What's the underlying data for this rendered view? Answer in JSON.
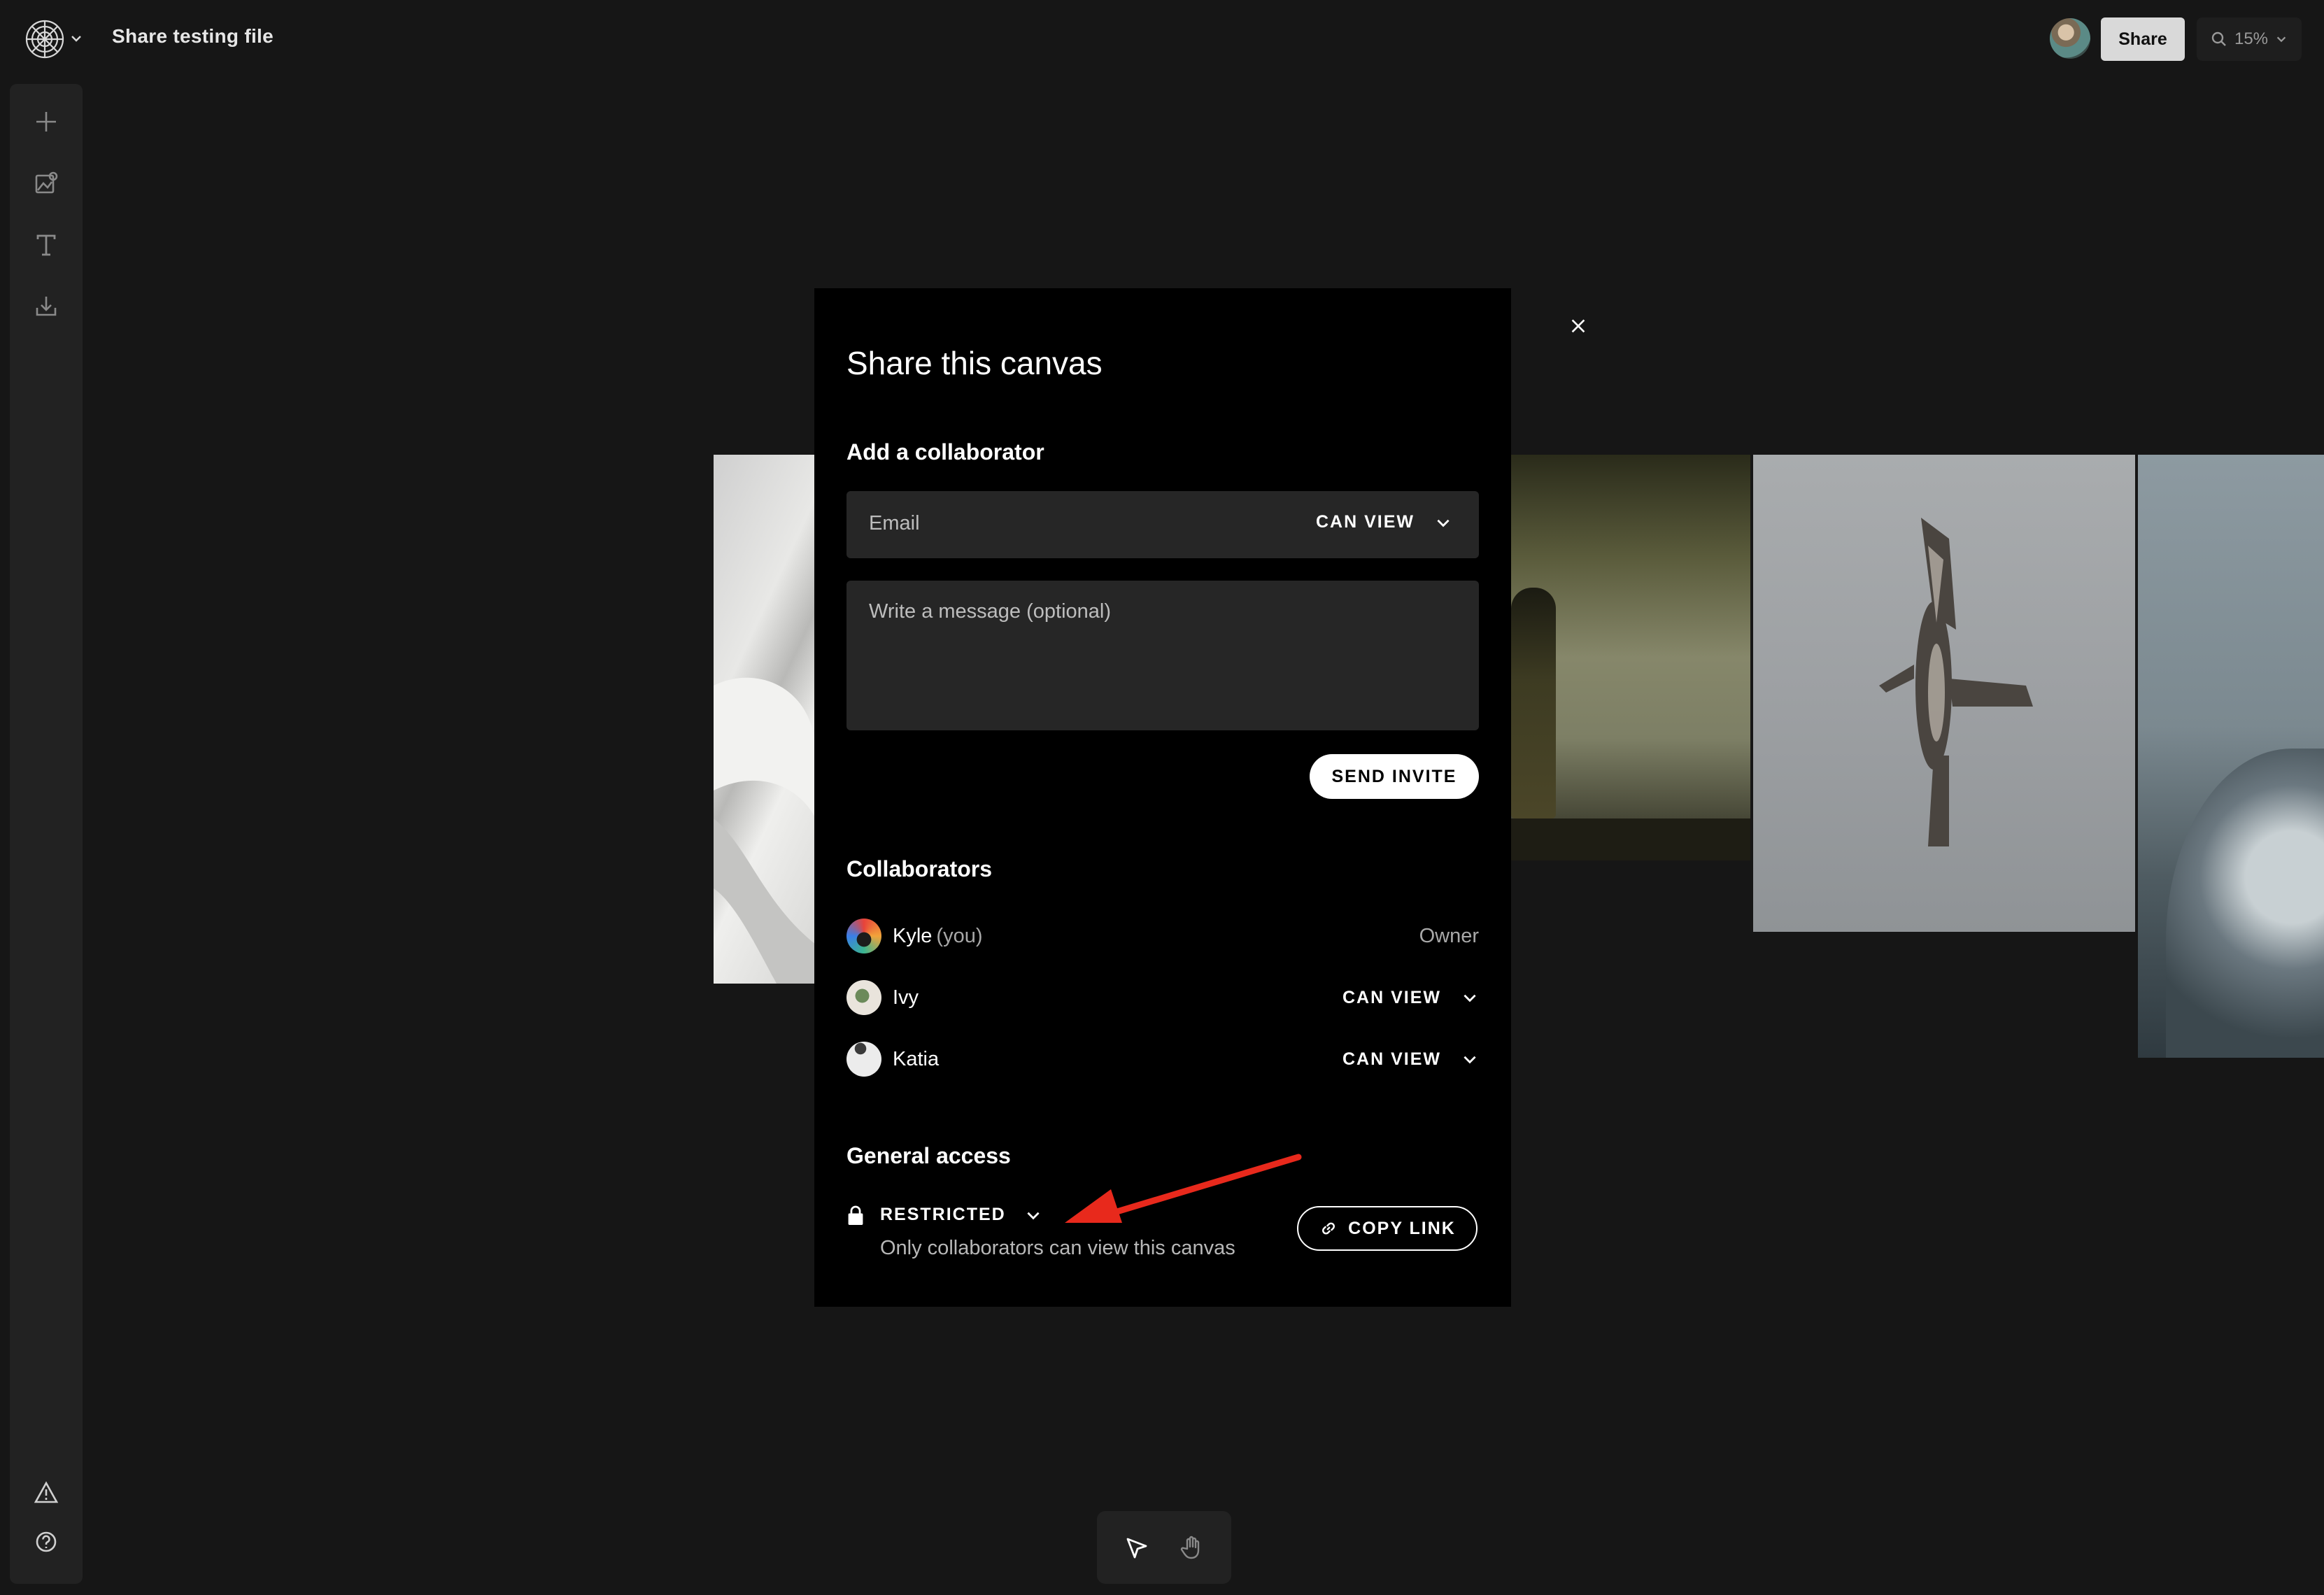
{
  "header": {
    "file_title": "Share testing file",
    "share_label": "Share",
    "zoom_label": "15%"
  },
  "modal": {
    "title": "Share this canvas",
    "add_heading": "Add a collaborator",
    "email_placeholder": "Email",
    "email_permission": "CAN VIEW",
    "message_placeholder": "Write a message (optional)",
    "send_label": "SEND INVITE",
    "collaborators_heading": "Collaborators",
    "collaborators": [
      {
        "name": "Kyle",
        "suffix": "(you)",
        "role": "Owner"
      },
      {
        "name": "Ivy",
        "permission": "CAN VIEW"
      },
      {
        "name": "Katia",
        "permission": "CAN VIEW"
      }
    ],
    "general_heading": "General access",
    "access_level": "RESTRICTED",
    "access_desc": "Only collaborators can view this canvas",
    "copy_link_label": "COPY LINK"
  },
  "colors": {
    "background": "#161616",
    "panel": "#222222",
    "modal": "#000000",
    "field": "#262626",
    "annotation_arrow": "#e8291c"
  },
  "icons": [
    "logo-icon",
    "plus-icon",
    "image-icon",
    "text-icon",
    "upload-icon",
    "warning-icon",
    "help-icon",
    "close-icon",
    "chevron-down-icon",
    "lock-icon",
    "link-icon",
    "search-icon",
    "pointer-icon",
    "hand-icon"
  ]
}
